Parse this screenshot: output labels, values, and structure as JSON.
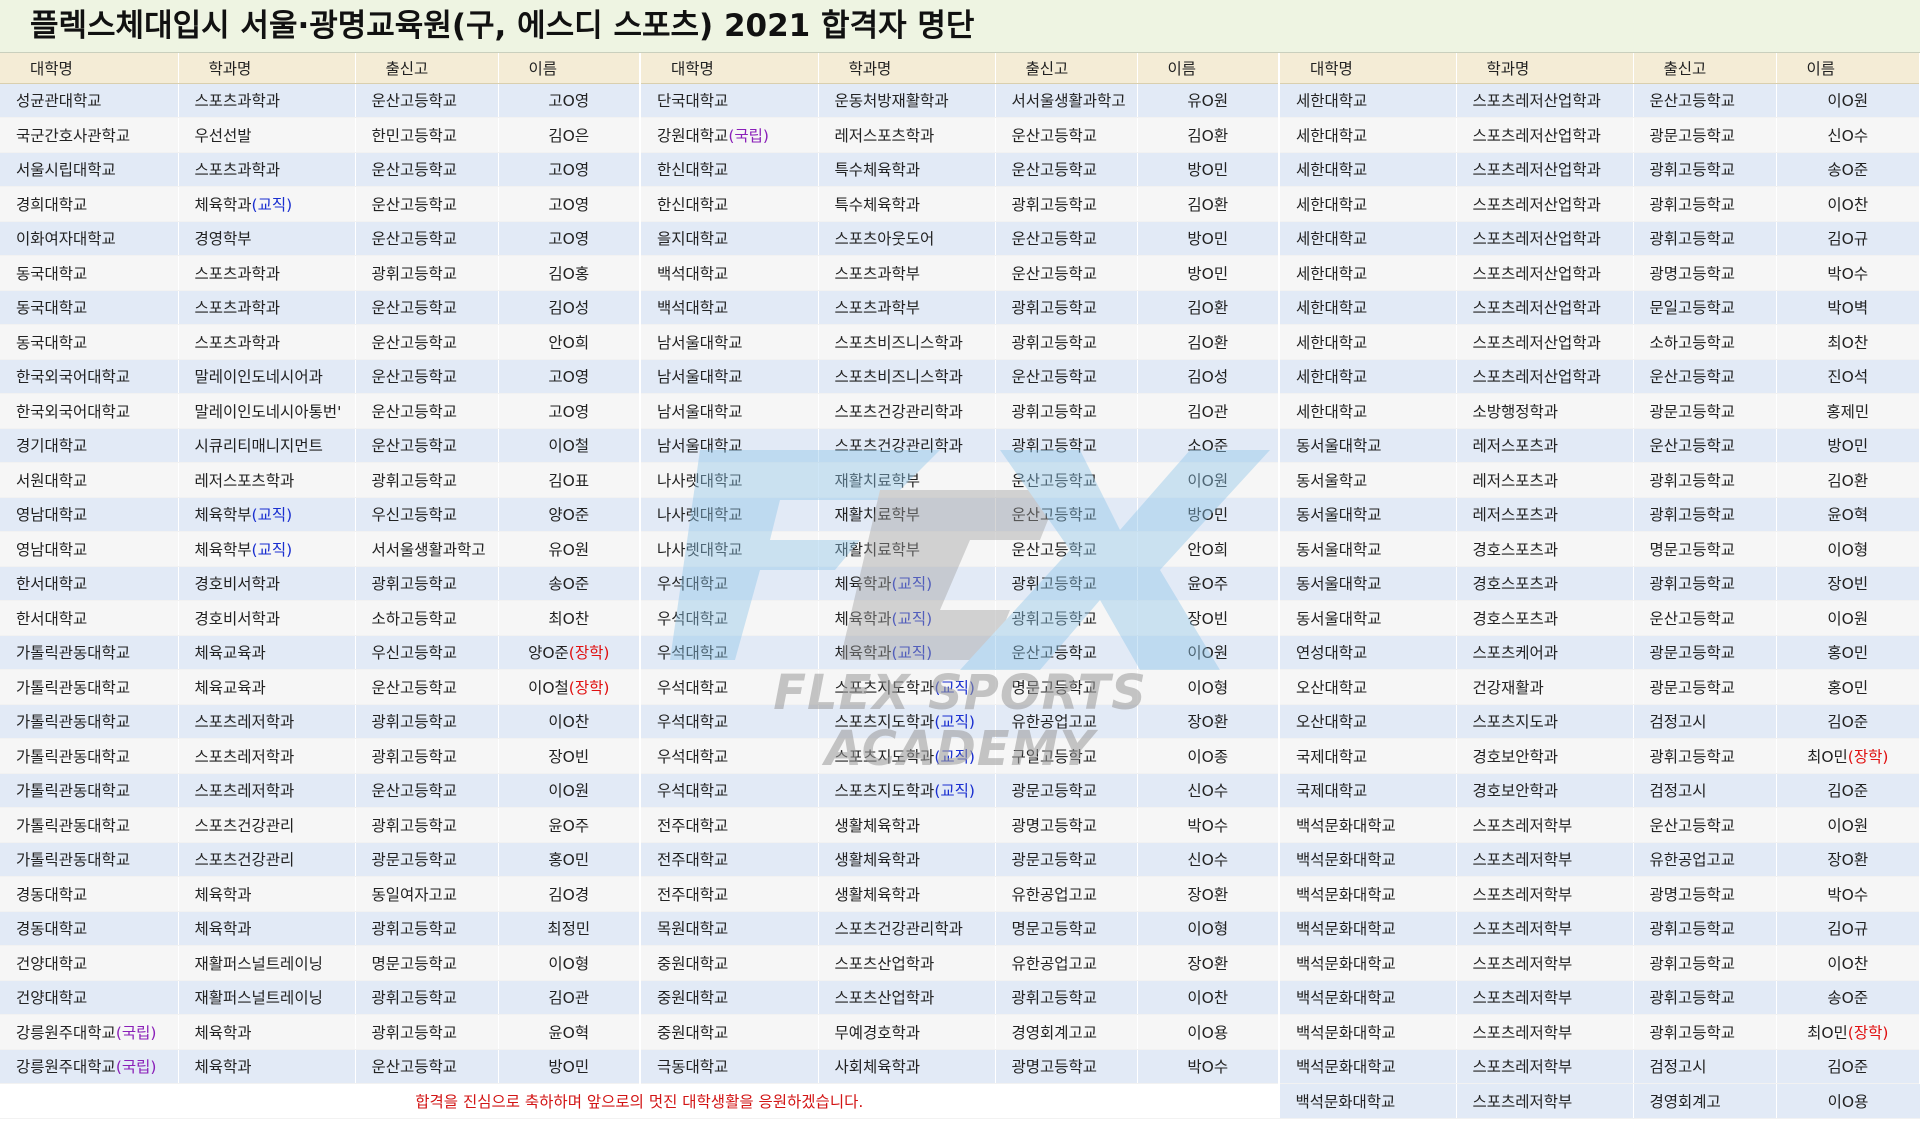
{
  "title": "플렉스체대입시 서울·광명교육원(구, 에스디 스포츠) 2021 합격자 명단",
  "headers": [
    "대학명",
    "학과명",
    "출신고",
    "이름"
  ],
  "tags": {
    "national": "(국립)",
    "teaching": "(교직)",
    "scholarship": "(장학)"
  },
  "footer_message": "합격을 진심으로 축하하며 앞으로의 멋진 대학생활을 응원하겠습니다.",
  "watermark": "FLEX SPORTS ACADEMY",
  "colors": {
    "title_bg": "#eef4e2",
    "header_bg": "#f4ecd6",
    "row_blue": "#e2eaf6",
    "row_gray": "#f6f6f6",
    "national": "#8a1fb8",
    "teaching": "#1a2fd0",
    "scholarship": "#e01010",
    "footer": "#d21414"
  },
  "rows": [
    [
      [
        "성균관대학교",
        "",
        "스포츠과학과",
        "",
        "운산고등학교",
        "고O영",
        ""
      ],
      [
        "단국대학교",
        "",
        "운동처방재활학과",
        "",
        "서서울생활과학고",
        "유O원",
        ""
      ],
      [
        "세한대학교",
        "",
        "스포츠레저산업학과",
        "",
        "운산고등학교",
        "이O원",
        ""
      ]
    ],
    [
      [
        "국군간호사관학교",
        "",
        "우선선발",
        "",
        "한민고등학교",
        "김O은",
        ""
      ],
      [
        "강원대학교",
        "national",
        "레저스포츠학과",
        "",
        "운산고등학교",
        "김O환",
        ""
      ],
      [
        "세한대학교",
        "",
        "스포츠레저산업학과",
        "",
        "광문고등학교",
        "신O수",
        ""
      ]
    ],
    [
      [
        "서울시립대학교",
        "",
        "스포츠과학과",
        "",
        "운산고등학교",
        "고O영",
        ""
      ],
      [
        "한신대학교",
        "",
        "특수체육학과",
        "",
        "운산고등학교",
        "방O민",
        ""
      ],
      [
        "세한대학교",
        "",
        "스포츠레저산업학과",
        "",
        "광휘고등학교",
        "송O준",
        ""
      ]
    ],
    [
      [
        "경희대학교",
        "",
        "체육학과",
        "teaching",
        "운산고등학교",
        "고O영",
        ""
      ],
      [
        "한신대학교",
        "",
        "특수체육학과",
        "",
        "광휘고등학교",
        "김O환",
        ""
      ],
      [
        "세한대학교",
        "",
        "스포츠레저산업학과",
        "",
        "광휘고등학교",
        "이O찬",
        ""
      ]
    ],
    [
      [
        "이화여자대학교",
        "",
        "경영학부",
        "",
        "운산고등학교",
        "고O영",
        ""
      ],
      [
        "을지대학교",
        "",
        "스포츠아웃도어",
        "",
        "운산고등학교",
        "방O민",
        ""
      ],
      [
        "세한대학교",
        "",
        "스포츠레저산업학과",
        "",
        "광휘고등학교",
        "김O규",
        ""
      ]
    ],
    [
      [
        "동국대학교",
        "",
        "스포츠과학과",
        "",
        "광휘고등학교",
        "김O홍",
        ""
      ],
      [
        "백석대학교",
        "",
        "스포츠과학부",
        "",
        "운산고등학교",
        "방O민",
        ""
      ],
      [
        "세한대학교",
        "",
        "스포츠레저산업학과",
        "",
        "광명고등학교",
        "박O수",
        ""
      ]
    ],
    [
      [
        "동국대학교",
        "",
        "스포츠과학과",
        "",
        "운산고등학교",
        "김O성",
        ""
      ],
      [
        "백석대학교",
        "",
        "스포츠과학부",
        "",
        "광휘고등학교",
        "김O환",
        ""
      ],
      [
        "세한대학교",
        "",
        "스포츠레저산업학과",
        "",
        "문일고등학교",
        "박O벽",
        ""
      ]
    ],
    [
      [
        "동국대학교",
        "",
        "스포츠과학과",
        "",
        "운산고등학교",
        "안O희",
        ""
      ],
      [
        "남서울대학교",
        "",
        "스포츠비즈니스학과",
        "",
        "광휘고등학교",
        "김O환",
        ""
      ],
      [
        "세한대학교",
        "",
        "스포츠레저산업학과",
        "",
        "소하고등학교",
        "최O찬",
        ""
      ]
    ],
    [
      [
        "한국외국어대학교",
        "",
        "말레이인도네시어과",
        "",
        "운산고등학교",
        "고O영",
        ""
      ],
      [
        "남서울대학교",
        "",
        "스포츠비즈니스학과",
        "",
        "운산고등학교",
        "김O성",
        ""
      ],
      [
        "세한대학교",
        "",
        "스포츠레저산업학과",
        "",
        "운산고등학교",
        "진O석",
        ""
      ]
    ],
    [
      [
        "한국외국어대학교",
        "",
        "말레이인도네시아통번'",
        "",
        "운산고등학교",
        "고O영",
        ""
      ],
      [
        "남서울대학교",
        "",
        "스포츠건강관리학과",
        "",
        "광휘고등학교",
        "김O관",
        ""
      ],
      [
        "세한대학교",
        "",
        "소방행정학과",
        "",
        "광문고등학교",
        "홍제민",
        ""
      ]
    ],
    [
      [
        "경기대학교",
        "",
        "시큐리티매니지먼트",
        "",
        "운산고등학교",
        "이O철",
        ""
      ],
      [
        "남서울대학교",
        "",
        "스포츠건강관리학과",
        "",
        "광휘고등학교",
        "소O준",
        ""
      ],
      [
        "동서울대학교",
        "",
        "레저스포츠과",
        "",
        "운산고등학교",
        "방O민",
        ""
      ]
    ],
    [
      [
        "서원대학교",
        "",
        "레저스포츠학과",
        "",
        "광휘고등학교",
        "김O표",
        ""
      ],
      [
        "나사렛대학교",
        "",
        "재활치료학부",
        "",
        "운산고등학교",
        "이O원",
        ""
      ],
      [
        "동서울학교",
        "",
        "레저스포츠과",
        "",
        "광휘고등학교",
        "김O환",
        ""
      ]
    ],
    [
      [
        "영남대학교",
        "",
        "체육학부",
        "teaching",
        "우신고등학교",
        "양O준",
        ""
      ],
      [
        "나사렛대학교",
        "",
        "재활치료학부",
        "",
        "운산고등학교",
        "방O민",
        ""
      ],
      [
        "동서울대학교",
        "",
        "레저스포츠과",
        "",
        "광휘고등학교",
        "윤O혁",
        ""
      ]
    ],
    [
      [
        "영남대학교",
        "",
        "체육학부",
        "teaching",
        "서서울생활과학고",
        "유O원",
        ""
      ],
      [
        "나사렛대학교",
        "",
        "재활치료학부",
        "",
        "운산고등학교",
        "안O희",
        ""
      ],
      [
        "동서울대학교",
        "",
        "경호스포츠과",
        "",
        "명문고등학교",
        "이O형",
        ""
      ]
    ],
    [
      [
        "한서대학교",
        "",
        "경호비서학과",
        "",
        "광휘고등학교",
        "송O준",
        ""
      ],
      [
        "우석대학교",
        "",
        "체육학과",
        "teaching",
        "광휘고등학교",
        "윤O주",
        ""
      ],
      [
        "동서울대학교",
        "",
        "경호스포츠과",
        "",
        "광휘고등학교",
        "장O빈",
        ""
      ]
    ],
    [
      [
        "한서대학교",
        "",
        "경호비서학과",
        "",
        "소하고등학교",
        "최O찬",
        ""
      ],
      [
        "우석대학교",
        "",
        "체육학과",
        "teaching",
        "광휘고등학교",
        "장O빈",
        ""
      ],
      [
        "동서울대학교",
        "",
        "경호스포츠과",
        "",
        "운산고등학교",
        "이O원",
        ""
      ]
    ],
    [
      [
        "가톨릭관동대학교",
        "",
        "체육교육과",
        "",
        "우신고등학교",
        "양O준",
        "scholarship"
      ],
      [
        "우석대학교",
        "",
        "체육학과",
        "teaching",
        "운산고등학교",
        "이O원",
        ""
      ],
      [
        "연성대학교",
        "",
        "스포츠케어과",
        "",
        "광문고등학교",
        "홍O민",
        ""
      ]
    ],
    [
      [
        "가톨릭관동대학교",
        "",
        "체육교육과",
        "",
        "운산고등학교",
        "이O철",
        "scholarship"
      ],
      [
        "우석대학교",
        "",
        "스포츠지도학과",
        "teaching",
        "명문고등학교",
        "이O형",
        ""
      ],
      [
        "오산대학교",
        "",
        "건강재활과",
        "",
        "광문고등학교",
        "홍O민",
        ""
      ]
    ],
    [
      [
        "가톨릭관동대학교",
        "",
        "스포츠레저학과",
        "",
        "광휘고등학교",
        "이O찬",
        ""
      ],
      [
        "우석대학교",
        "",
        "스포츠지도학과",
        "teaching",
        "유한공업고교",
        "장O환",
        ""
      ],
      [
        "오산대학교",
        "",
        "스포츠지도과",
        "",
        "검정고시",
        "김O준",
        ""
      ]
    ],
    [
      [
        "가톨릭관동대학교",
        "",
        "스포츠레저학과",
        "",
        "광휘고등학교",
        "장O빈",
        ""
      ],
      [
        "우석대학교",
        "",
        "스포츠지도학과",
        "teaching",
        "구일고등학교",
        "이O종",
        ""
      ],
      [
        "국제대학교",
        "",
        "경호보안학과",
        "",
        "광휘고등학교",
        "최O민",
        "scholarship"
      ]
    ],
    [
      [
        "가톨릭관동대학교",
        "",
        "스포츠레저학과",
        "",
        "운산고등학교",
        "이O원",
        ""
      ],
      [
        "우석대학교",
        "",
        "스포츠지도학과",
        "teaching",
        "광문고등학교",
        "신O수",
        ""
      ],
      [
        "국제대학교",
        "",
        "경호보안학과",
        "",
        "검정고시",
        "김O준",
        ""
      ]
    ],
    [
      [
        "가톨릭관동대학교",
        "",
        "스포츠건강관리",
        "",
        "광휘고등학교",
        "윤O주",
        ""
      ],
      [
        "전주대학교",
        "",
        "생활체육학과",
        "",
        "광명고등학교",
        "박O수",
        ""
      ],
      [
        "백석문화대학교",
        "",
        "스포츠레저학부",
        "",
        "운산고등학교",
        "이O원",
        ""
      ]
    ],
    [
      [
        "가톨릭관동대학교",
        "",
        "스포츠건강관리",
        "",
        "광문고등학교",
        "홍O민",
        ""
      ],
      [
        "전주대학교",
        "",
        "생활체육학과",
        "",
        "광문고등학교",
        "신O수",
        ""
      ],
      [
        "백석문화대학교",
        "",
        "스포츠레저학부",
        "",
        "유한공업고교",
        "장O환",
        ""
      ]
    ],
    [
      [
        "경동대학교",
        "",
        "체육학과",
        "",
        "동일여자고교",
        "김O경",
        ""
      ],
      [
        "전주대학교",
        "",
        "생활체육학과",
        "",
        "유한공업고교",
        "장O환",
        ""
      ],
      [
        "백석문화대학교",
        "",
        "스포츠레저학부",
        "",
        "광명고등학교",
        "박O수",
        ""
      ]
    ],
    [
      [
        "경동대학교",
        "",
        "체육학과",
        "",
        "광휘고등학교",
        "최정민",
        ""
      ],
      [
        "목원대학교",
        "",
        "스포츠건강관리학과",
        "",
        "명문고등학교",
        "이O형",
        ""
      ],
      [
        "백석문화대학교",
        "",
        "스포츠레저학부",
        "",
        "광휘고등학교",
        "김O규",
        ""
      ]
    ],
    [
      [
        "건양대학교",
        "",
        "재활퍼스널트레이닝",
        "",
        "명문고등학교",
        "이O형",
        ""
      ],
      [
        "중원대학교",
        "",
        "스포츠산업학과",
        "",
        "유한공업고교",
        "장O환",
        ""
      ],
      [
        "백석문화대학교",
        "",
        "스포츠레저학부",
        "",
        "광휘고등학교",
        "이O찬",
        ""
      ]
    ],
    [
      [
        "건양대학교",
        "",
        "재활퍼스널트레이닝",
        "",
        "광휘고등학교",
        "김O관",
        ""
      ],
      [
        "중원대학교",
        "",
        "스포츠산업학과",
        "",
        "광휘고등학교",
        "이O찬",
        ""
      ],
      [
        "백석문화대학교",
        "",
        "스포츠레저학부",
        "",
        "광휘고등학교",
        "송O준",
        ""
      ]
    ],
    [
      [
        "강릉원주대학교",
        "national",
        "체육학과",
        "",
        "광휘고등학교",
        "윤O혁",
        ""
      ],
      [
        "중원대학교",
        "",
        "무예경호학과",
        "",
        "경영회계고교",
        "이O용",
        ""
      ],
      [
        "백석문화대학교",
        "",
        "스포츠레저학부",
        "",
        "광휘고등학교",
        "최O민",
        "scholarship"
      ]
    ],
    [
      [
        "강릉원주대학교",
        "national",
        "체육학과",
        "",
        "운산고등학교",
        "방O민",
        ""
      ],
      [
        "극동대학교",
        "",
        "사회체육학과",
        "",
        "광명고등학교",
        "박O수",
        ""
      ],
      [
        "백석문화대학교",
        "",
        "스포츠레저학부",
        "",
        "검정고시",
        "김O준",
        ""
      ]
    ]
  ],
  "last_row_right": [
    "백석문화대학교",
    "스포츠레저학부",
    "경영회계고",
    "이O용"
  ]
}
